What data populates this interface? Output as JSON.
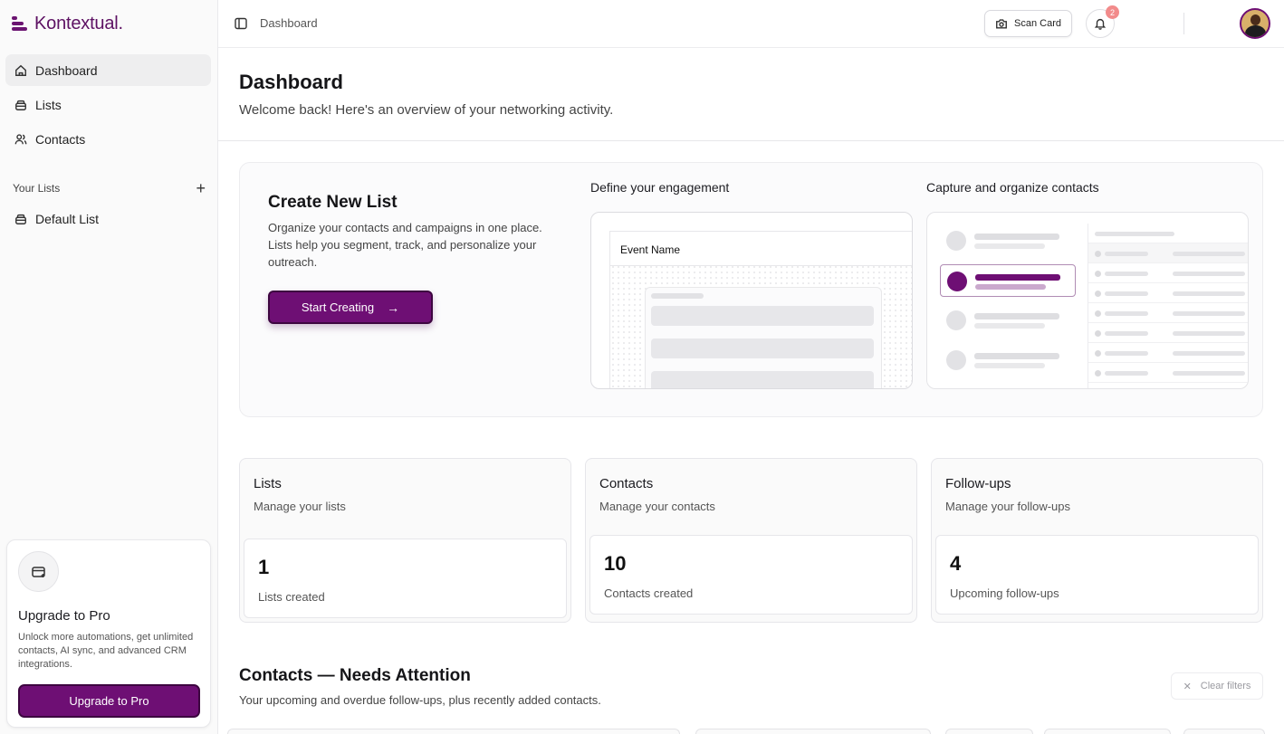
{
  "app": {
    "brand": "Kontextual.",
    "accent_color": "#6e0f74"
  },
  "sidebar": {
    "nav": [
      {
        "label": "Dashboard",
        "icon": "home-icon",
        "active": true
      },
      {
        "label": "Lists",
        "icon": "stack-icon",
        "active": false
      },
      {
        "label": "Contacts",
        "icon": "users-icon",
        "active": false
      }
    ],
    "your_lists_label": "Your Lists",
    "lists": [
      {
        "label": "Default List",
        "icon": "stack-icon"
      }
    ],
    "upgrade": {
      "title": "Upgrade to Pro",
      "description": "Unlock more automations, get unlimited contacts, AI sync, and advanced CRM integrations.",
      "button": "Upgrade to Pro"
    }
  },
  "topbar": {
    "breadcrumb": "Dashboard",
    "scan_button": "Scan Card",
    "notification_count": "2"
  },
  "main": {
    "title": "Dashboard",
    "subtitle": "Welcome back! Here's an overview of your networking activity.",
    "hero": {
      "title": "Create New List",
      "description": "Organize your contacts and campaigns in one place. Lists help you segment, track, and personalize your outreach.",
      "button": "Start Creating",
      "col1_heading": "Define your engagement",
      "col2_heading": "Capture and organize contacts",
      "preview_field": "Event Name"
    },
    "stats": [
      {
        "title": "Lists",
        "subtitle": "Manage your lists",
        "value": "1",
        "label": "Lists created"
      },
      {
        "title": "Contacts",
        "subtitle": "Manage your contacts",
        "value": "10",
        "label": "Contacts created"
      },
      {
        "title": "Follow-ups",
        "subtitle": "Manage your follow-ups",
        "value": "4",
        "label": "Upcoming follow-ups"
      }
    ],
    "attention": {
      "title": "Contacts — Needs Attention",
      "subtitle": "Your upcoming and overdue follow-ups, plus recently added contacts.",
      "clear_button": "Clear filters"
    }
  }
}
